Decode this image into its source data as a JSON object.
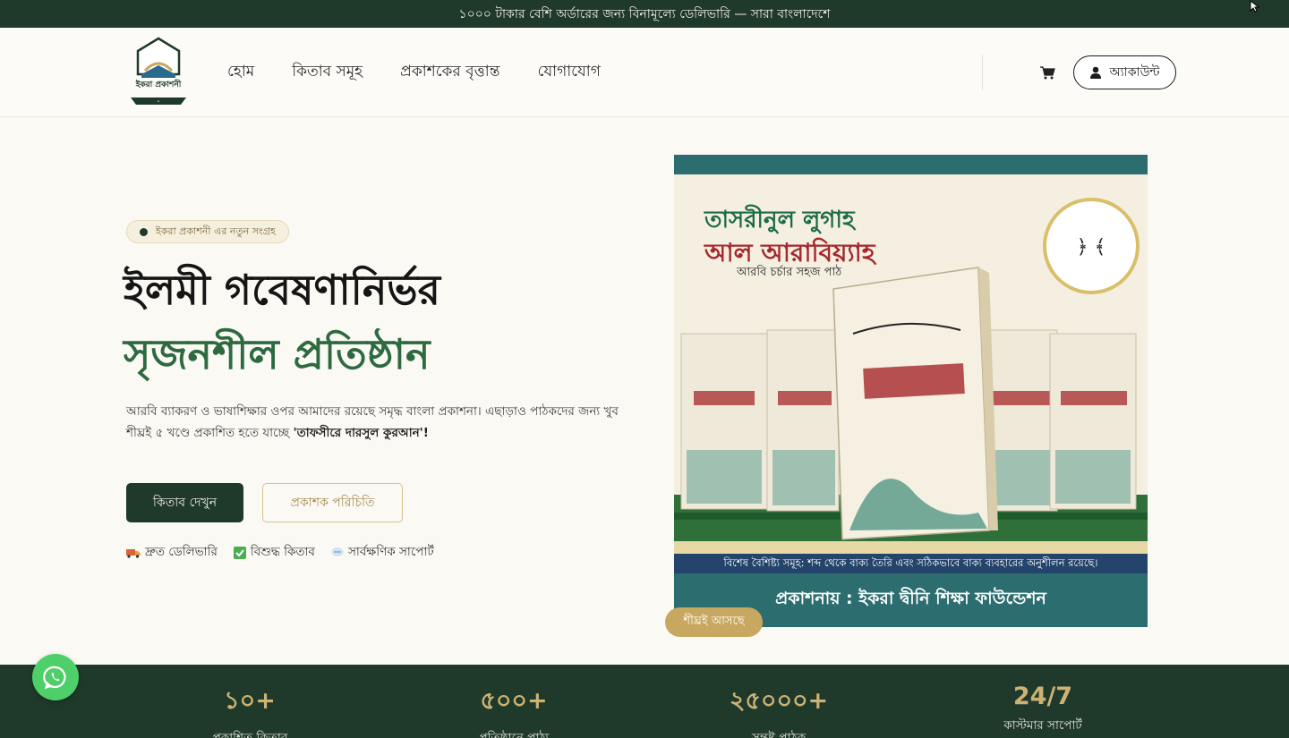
{
  "topbar": {
    "text": "১০০০ টাকার বেশি অর্ডারের জন্য বিনামূল্যে ডেলিভারি — সারা বাংলাদেশে"
  },
  "logo": {
    "text": "ইকরা প্রকাশনী"
  },
  "nav": {
    "items": [
      {
        "label": "হোম"
      },
      {
        "label": "কিতাব সমূহ"
      },
      {
        "label": "প্রকাশকের বৃত্তান্ত"
      },
      {
        "label": "যোগাযোগ"
      }
    ]
  },
  "header": {
    "cart_icon": "cart-icon",
    "account_label": "অ্যাকাউন্ট"
  },
  "hero": {
    "badge": "ইকরা প্রকাশনী এর নতুন সংগ্রহ",
    "title_line1": "ইলমী গবেষণানির্ভর",
    "title_line2": "সৃজনশীল প্রতিষ্ঠান",
    "description": "আরবি ব্যাকরণ ও ভাষাশিক্ষার ওপর আমাদের রয়েছে সমৃদ্ধ বাংলা প্রকাশনা। এছাড়াও পাঠকদের জন্য খুব শীঘ্রই ৫ খণ্ডে প্রকাশিত হতে যাচ্ছে",
    "description_bold": "'তাফসীরে দারসুল কুরআন'!",
    "primary_button": "কিতাব দেখুন",
    "secondary_button": "প্রকাশক পরিচিতি",
    "features": [
      {
        "icon": "truck-icon",
        "label": "দ্রুত ডেলিভারি"
      },
      {
        "icon": "check-icon",
        "label": "বিশুদ্ধ কিতাব"
      },
      {
        "icon": "chat-icon",
        "label": "সার্বক্ষণিক সাপোর্ট"
      }
    ]
  },
  "hero_image": {
    "title1": "তাসরীনুল লুগাহ",
    "title2": "আল আরাবিয়্যাহ",
    "subtitle": "আরবি চর্চার সহজ পাঠ",
    "strip": "বিশেষ বৈশিষ্ট্য সমূহ: শব্দ থেকে বাক্য তৈরি এবং সঠিকভাবে বাক্য ব্যবহারের অনুশীলন রয়েছে।",
    "publisher": "প্রকাশনায় : ইকরা দ্বীনি শিক্ষা ফাউন্ডেশন",
    "coming_soon": "শীঘ্রই আসছে"
  },
  "stats": [
    {
      "value": "১০+",
      "label": "প্রকাশিত কিতাব"
    },
    {
      "value": "৫০০+",
      "label": "প্রতিষ্ঠানে পাঠ্য"
    },
    {
      "value": "২৫০০০+",
      "label": "সন্তুষ্ট পাঠক"
    },
    {
      "value": "24/7",
      "label": "কাস্টমার সাপোর্ট"
    }
  ],
  "colors": {
    "primary": "#1f3a2b",
    "accent_gold": "#c8a860",
    "hero_green": "#2e6a40",
    "whatsapp": "#4fcf6a"
  }
}
